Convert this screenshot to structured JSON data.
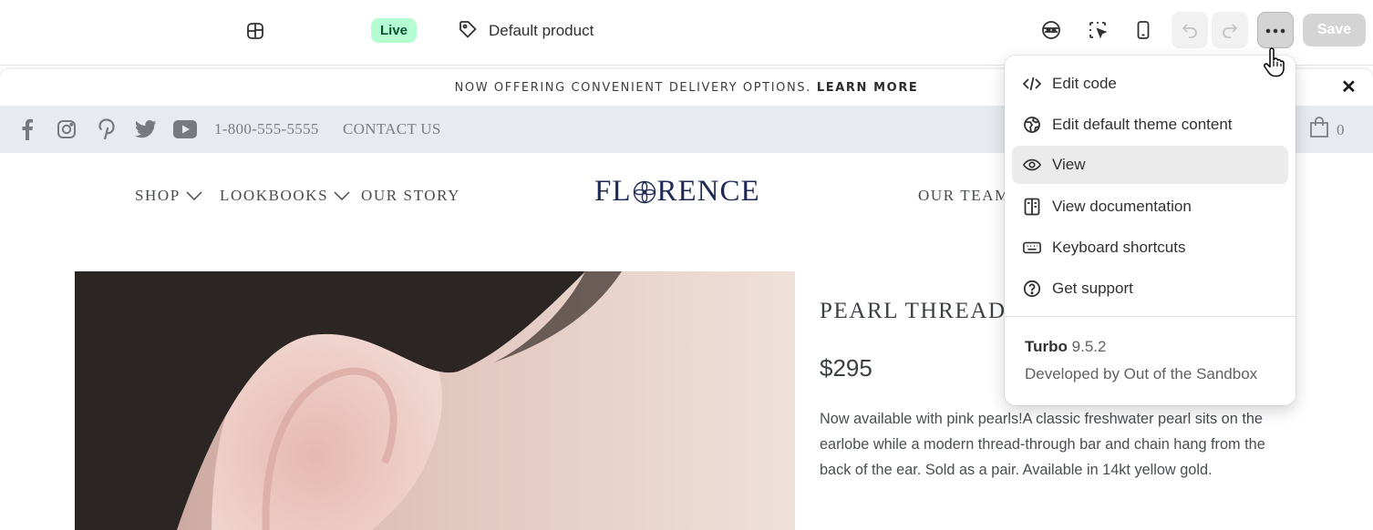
{
  "topbar": {
    "layout_icon": "layout-icon",
    "status_badge": "Live",
    "product_icon": "tag-icon",
    "product_label": "Default product",
    "actions": [
      "theme-icon",
      "inspect-icon",
      "mobile-icon",
      "undo-icon",
      "redo-icon",
      "more-icon"
    ],
    "save_label": "Save"
  },
  "storefront": {
    "announcement": {
      "text": "NOW OFFERING CONVENIENT DELIVERY OPTIONS.",
      "link": "LEARN MORE",
      "close": "✕"
    },
    "utility_bar": {
      "social": [
        "facebook-icon",
        "instagram-icon",
        "pinterest-icon",
        "twitter-icon",
        "youtube-icon"
      ],
      "phone": "1-800-555-5555",
      "contact": "CONTACT US",
      "cart_count": "0"
    },
    "nav": {
      "left": [
        "SHOP",
        "LOOKBOOKS",
        "OUR STORY"
      ],
      "logo_pre": "FL",
      "logo_post": "RENCE",
      "right": "OUR TEAM"
    },
    "product": {
      "title": "PEARL THREADER",
      "price": "$295",
      "description": "Now available with pink pearls!A classic freshwater pearl sits on the earlobe while a modern thread-through bar and chain hang from the back of the ear. Sold as a pair.  Available in 14kt yellow gold."
    }
  },
  "menu": {
    "items": [
      {
        "label": "Edit code",
        "icon": "code-icon"
      },
      {
        "label": "Edit default theme content",
        "icon": "globe-icon"
      },
      {
        "label": "View",
        "icon": "eye-icon"
      },
      {
        "label": "View documentation",
        "icon": "book-icon"
      },
      {
        "label": "Keyboard shortcuts",
        "icon": "keyboard-icon"
      },
      {
        "label": "Get support",
        "icon": "help-icon"
      }
    ],
    "active_item": "View",
    "theme_name": "Turbo",
    "theme_version": "9.5.2",
    "developer": "Developed by Out of the Sandbox"
  },
  "colors": {
    "live_badge_bg": "#b4fed2",
    "utility_bar_bg": "#e7ebf0",
    "logo": "#1f2a55"
  }
}
